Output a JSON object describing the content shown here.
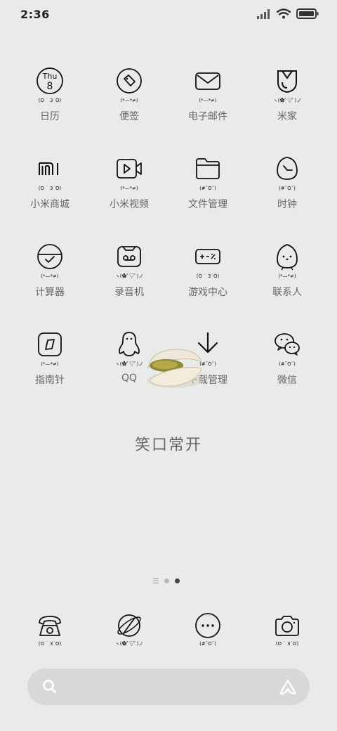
{
  "status": {
    "time": "2:36"
  },
  "apps": [
    {
      "label": "日历",
      "kaomoji": "(O ˙ 3˙O)",
      "icon": "calendar-icon",
      "day": "Thu",
      "date": "8"
    },
    {
      "label": "便签",
      "kaomoji": "(*—*≠)",
      "icon": "notes-icon"
    },
    {
      "label": "电子邮件",
      "kaomoji": "(*—*≠)",
      "icon": "mail-icon"
    },
    {
      "label": "米家",
      "kaomoji": "ヽ(✿ﾟ▽ﾟ)ノ",
      "icon": "mijia-icon"
    },
    {
      "label": "小米商城",
      "kaomoji": "(O ˙ 3˙O)",
      "icon": "mi-store-icon"
    },
    {
      "label": "小米视频",
      "kaomoji": "(*—*≠)",
      "icon": "video-icon"
    },
    {
      "label": "文件管理",
      "kaomoji": "(#ˇOˇ)",
      "icon": "folder-icon"
    },
    {
      "label": "时钟",
      "kaomoji": "(#ˇOˇ)",
      "icon": "clock-icon"
    },
    {
      "label": "计算器",
      "kaomoji": "(*—*≠)",
      "icon": "calculator-icon"
    },
    {
      "label": "录音机",
      "kaomoji": "ヽ(✿ﾟ▽ﾟ)ノ",
      "icon": "recorder-icon"
    },
    {
      "label": "游戏中心",
      "kaomoji": "(O ˙ 3˙O)",
      "icon": "gamepad-icon"
    },
    {
      "label": "联系人",
      "kaomoji": "(*—*≠)",
      "icon": "contacts-icon"
    },
    {
      "label": "指南针",
      "kaomoji": "(*—*≠)",
      "icon": "compass-icon"
    },
    {
      "label": "QQ",
      "kaomoji": "ヽ(✿ﾟ▽ﾟ)ノ",
      "icon": "penguin-icon"
    },
    {
      "label": "下载管理",
      "kaomoji": "(#ˇOˇ)",
      "icon": "download-icon"
    },
    {
      "label": "微信",
      "kaomoji": "(#ˇOˇ)",
      "icon": "wechat-icon"
    }
  ],
  "center_text": "笑口常开",
  "dock": [
    {
      "kaomoji": "(O ˙ 3˙O)",
      "icon": "phone-icon"
    },
    {
      "kaomoji": "ヽ(✿ﾟ▽ﾟ)ノ",
      "icon": "browser-icon"
    },
    {
      "kaomoji": "(#ˇOˇ)",
      "icon": "messages-icon"
    },
    {
      "kaomoji": "(O ˙ 3˙O)",
      "icon": "camera-icon"
    }
  ],
  "page_indicator": {
    "pages": 2,
    "current": 2
  },
  "colors": {
    "background": "#e9ebea",
    "search_bar": "#d7d9d8",
    "label": "#666666"
  }
}
